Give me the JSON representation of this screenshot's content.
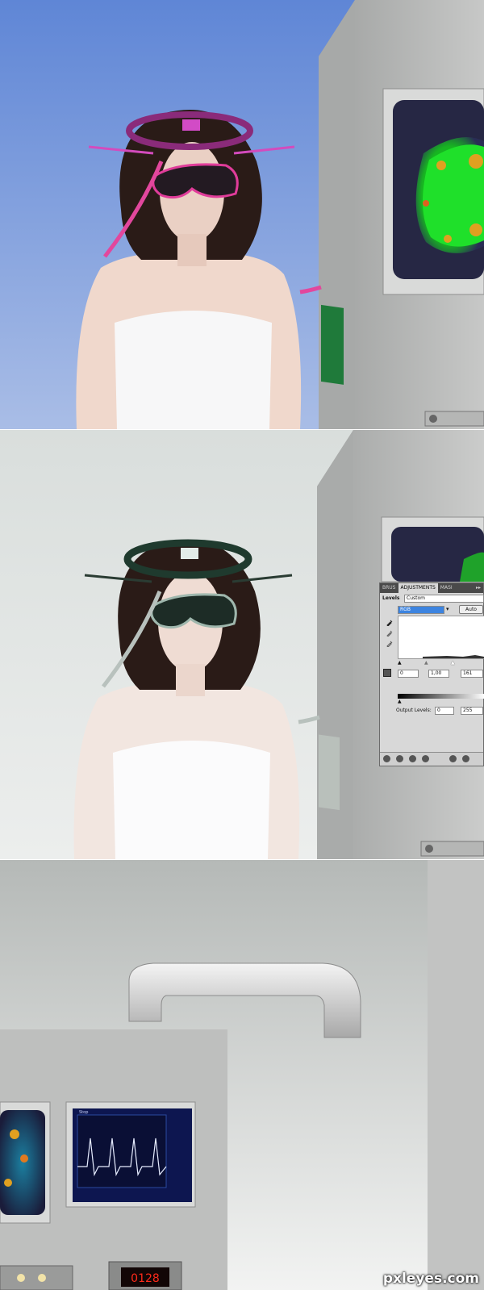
{
  "adjustments_panel": {
    "tabs": [
      "BRUS",
      "ADJUSTMENTS",
      "MASI"
    ],
    "menu_glyph": "▸▸",
    "adjustment_type": "Levels",
    "preset": "Custom",
    "channel": "RGB",
    "auto_label": "Auto",
    "input_levels": [
      "0",
      "1,00",
      "161"
    ],
    "output_levels_label": "Output Levels:",
    "output_levels": [
      "0",
      "255"
    ]
  },
  "oscilloscope": {
    "status_text": "Stop",
    "readout": "0128"
  },
  "watermark": "pxleyes.com",
  "colors": {
    "sky_blue": "#6a8fd8",
    "headgear_pink": "#e0409a",
    "headgear_green": "#1f3a2e",
    "monitor_glow": "#22c42a",
    "concrete": "#b8b9b8"
  }
}
